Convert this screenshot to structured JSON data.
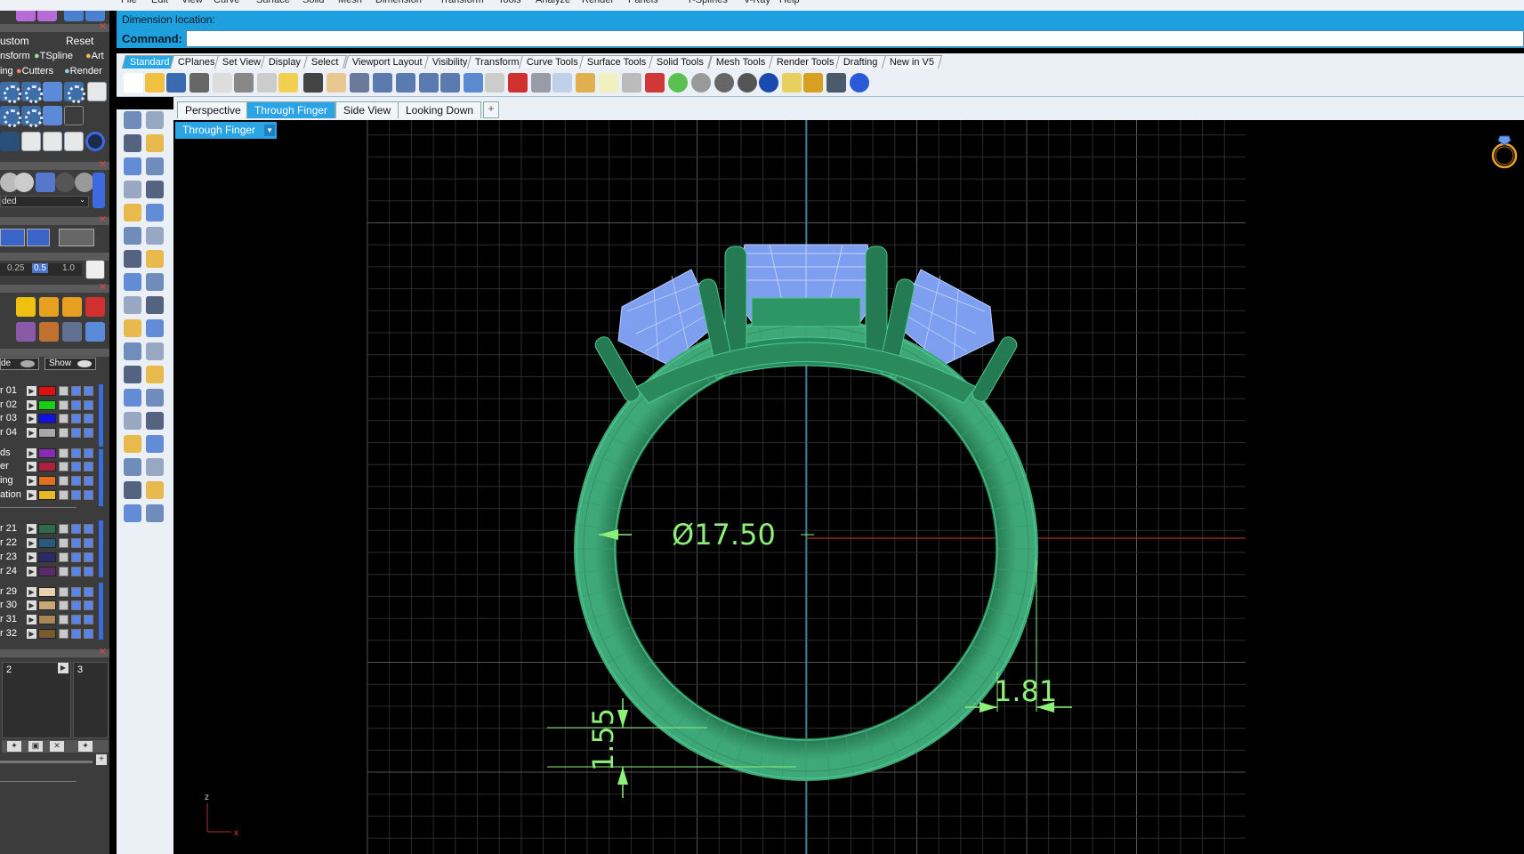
{
  "menu": [
    "File",
    "Edit",
    "View",
    "Curve",
    "Surface",
    "Solid",
    "Mesh",
    "Dimension",
    "Transform",
    "Tools",
    "Analyze",
    "Render",
    "Panels",
    "T-Splines",
    "V-Ray",
    "Help"
  ],
  "left_panel": {
    "preset_label": "ustom",
    "reset_label": "Reset",
    "tabs_row1": [
      "nsform",
      "TSpline",
      "Art"
    ],
    "tabs_row2": [
      "ing",
      "Cutters",
      "Render"
    ],
    "display_mode": "ded",
    "opacity_values": [
      "0.25",
      "0.5",
      "1.0"
    ],
    "layer_header": [
      "de",
      "Show"
    ],
    "layers": [
      {
        "name": "r 01",
        "color": "#e01010"
      },
      {
        "name": "r 02",
        "color": "#16d016"
      },
      {
        "name": "r 03",
        "color": "#1010e0"
      },
      {
        "name": "r 04",
        "color": "#a8a8a8"
      },
      {
        "name": "ds",
        "color": "#8a2bb8"
      },
      {
        "name": "er",
        "color": "#b02040"
      },
      {
        "name": "ing",
        "color": "#e07020"
      },
      {
        "name": "ation",
        "color": "#e8b820"
      },
      {
        "name": "r 21",
        "color": "#2f6a4a"
      },
      {
        "name": "r 22",
        "color": "#2a5a7a"
      },
      {
        "name": "r 23",
        "color": "#2a2a6a"
      },
      {
        "name": "r 24",
        "color": "#5a2a6a"
      },
      {
        "name": "r 29",
        "color": "#e8d0b0"
      },
      {
        "name": "r 30",
        "color": "#c8a878"
      },
      {
        "name": "r 31",
        "color": "#a88858"
      },
      {
        "name": "r 32",
        "color": "#785a30"
      }
    ],
    "snapshot_labels": [
      "2",
      "3"
    ]
  },
  "command": {
    "prompt_line": "Dimension location:",
    "label": "Command:",
    "value": ""
  },
  "toolbar_tabs": [
    "Standard",
    "CPlanes",
    "Set View",
    "Display",
    "Select",
    "Viewport Layout",
    "Visibility",
    "Transform",
    "Curve Tools",
    "Surface Tools",
    "Solid Tools",
    "Mesh Tools",
    "Render Tools",
    "Drafting",
    "New in V5"
  ],
  "active_toolbar_tab": "Standard",
  "viewport_tabs": [
    "Perspective",
    "Through Finger",
    "Side View",
    "Looking Down"
  ],
  "active_viewport_tab": "Through Finger",
  "viewport": {
    "title": "Through Finger",
    "axis_z": "z",
    "axis_x": "x",
    "dimensions": {
      "diameter": "Ø17.50",
      "width": "1.81",
      "height": "1.55"
    }
  },
  "colors": {
    "accent": "#27a7e3",
    "ring": "#2e8a5e",
    "gem": "#7e9ff0",
    "dimension": "#8ef07a",
    "grid": "#3a3a3a"
  }
}
